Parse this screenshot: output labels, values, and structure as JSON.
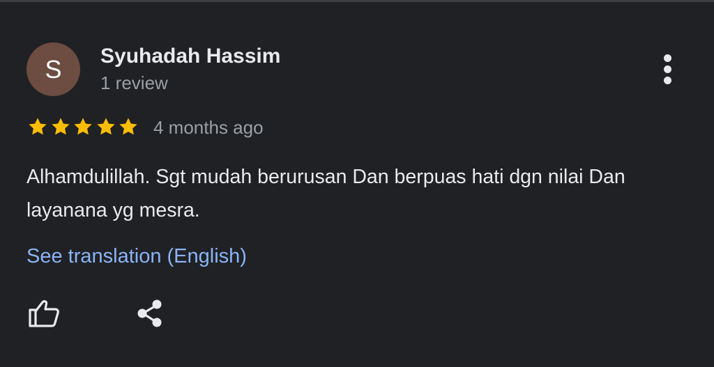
{
  "review": {
    "avatar_initial": "S",
    "author_name": "Syuhadah Hassim",
    "review_count": "1 review",
    "rating": 5,
    "rating_max": 5,
    "time_ago": "4 months ago",
    "text": "Alhamdulillah. Sgt mudah berurusan Dan berpuas hati dgn nilai Dan layanana yg mesra.",
    "translation_link": "See translation (English)"
  },
  "icons": {
    "more": "more-vert-icon",
    "like": "thumb-up-icon",
    "share": "share-icon",
    "star": "star-icon"
  },
  "colors": {
    "background": "#202124",
    "avatar": "#6d4c41",
    "star": "#fbbc04",
    "link": "#8ab4f8",
    "primary_text": "#e8eaed",
    "secondary_text": "#9aa0a6"
  }
}
